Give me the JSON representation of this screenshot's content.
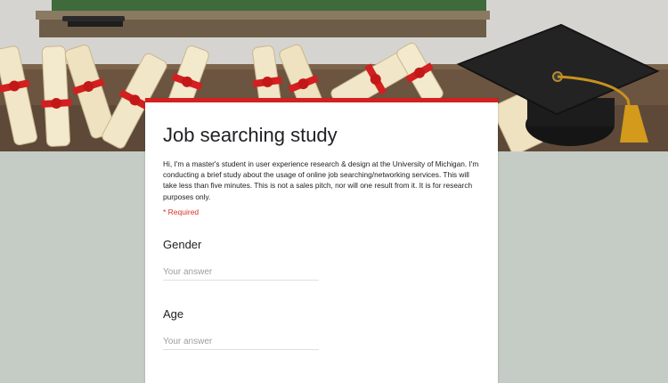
{
  "form": {
    "title": "Job searching study",
    "description": "Hi, I'm a master's student in user experience research & design at the University of Michigan. I'm conducting a brief study about the usage of online job searching/networking services. This will take less than five minutes. This is not a sales pitch, nor will one result from it.  It is for research purposes only.",
    "required_note": "* Required",
    "questions": [
      {
        "label": "Gender",
        "placeholder": "Your answer"
      },
      {
        "label": "Age",
        "placeholder": "Your answer"
      }
    ]
  },
  "colors": {
    "accent": "#d32020",
    "page_background": "#c4ccc5",
    "card_background": "#ffffff",
    "required": "#d93025"
  },
  "banner": {
    "theme": "graduation-illustration",
    "icons": [
      "chalkboard-icon",
      "diploma-scroll-icon",
      "graduation-cap-icon"
    ]
  }
}
